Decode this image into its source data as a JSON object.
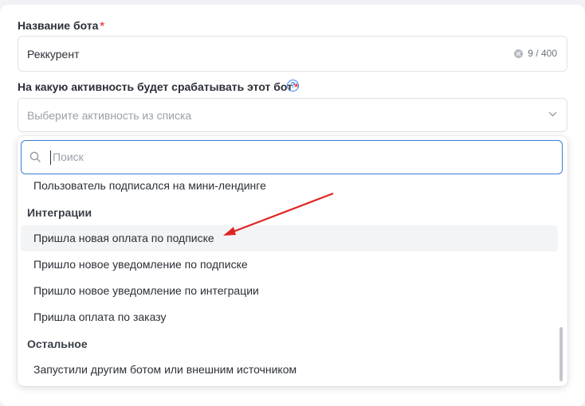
{
  "bot_name": {
    "label": "Название бота",
    "required_mark": "*",
    "value": "Реккурент",
    "counter": "9 / 400"
  },
  "activity": {
    "label": "На какую активность будет срабатывать этот бот",
    "required_mark": "*",
    "help_glyph": "?",
    "placeholder": "Выберите активность из списка"
  },
  "dropdown": {
    "search_placeholder": "Поиск",
    "prev_item": "Пользователь подписался на мини-лендинге",
    "groups": [
      {
        "title": "Интеграции",
        "items": [
          "Пришла новая оплата по подписке",
          "Пришло новое уведомление по подписке",
          "Пришло новое уведомление по интеграции",
          "Пришла оплата по заказу"
        ]
      },
      {
        "title": "Остальное",
        "items": [
          "Запустили другим ботом или внешним источником"
        ]
      }
    ],
    "hovered_item": "Пришла новая оплата по подписке"
  },
  "colors": {
    "accent": "#3a7bd5",
    "required": "#e5484d",
    "arrow": "#e02424"
  },
  "icons": [
    "clear-icon",
    "help-icon",
    "chevron-down-icon",
    "search-icon",
    "annotation-arrow"
  ]
}
